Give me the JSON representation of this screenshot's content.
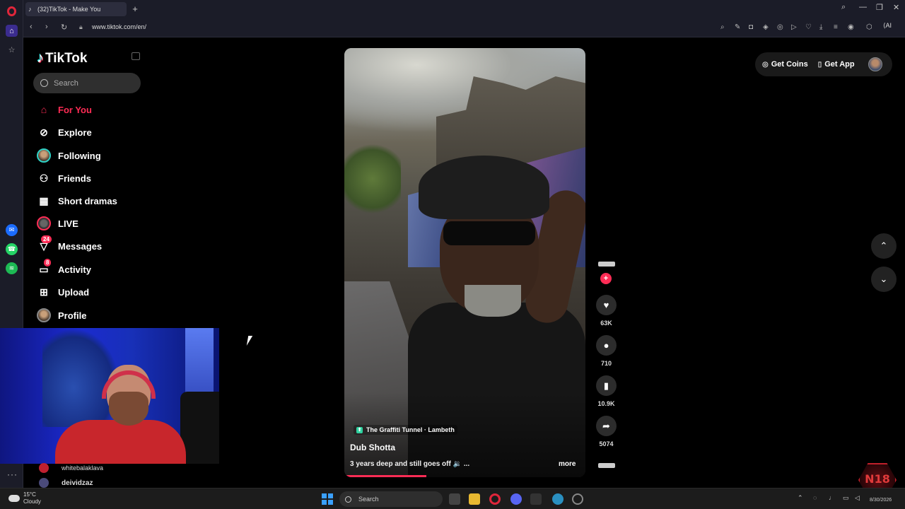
{
  "browser": {
    "tab_title": "(32)TikTok - Make You",
    "url": "www.tiktok.com/en/",
    "ai_label": "AI"
  },
  "tiktok": {
    "brand": "TikTok",
    "search_placeholder": "Search",
    "nav": [
      {
        "label": "For You",
        "icon": "home-icon",
        "active": true
      },
      {
        "label": "Explore",
        "icon": "compass-icon"
      },
      {
        "label": "Following",
        "icon": "following-avatar-icon"
      },
      {
        "label": "Friends",
        "icon": "friends-icon"
      },
      {
        "label": "Short dramas",
        "icon": "film-icon"
      },
      {
        "label": "LIVE",
        "icon": "live-icon"
      },
      {
        "label": "Messages",
        "icon": "messages-icon",
        "badge": "24"
      },
      {
        "label": "Activity",
        "icon": "activity-icon",
        "badge": "8"
      },
      {
        "label": "Upload",
        "icon": "upload-icon"
      },
      {
        "label": "Profile",
        "icon": "profile-avatar-icon"
      }
    ],
    "topbar": {
      "get_coins": "Get Coins",
      "get_app": "Get App"
    },
    "video": {
      "location": "The Graffiti Tunnel · Lambeth",
      "author": "Dub Shotta",
      "caption": "3 years deep and still goes off 🔉 ...",
      "more": "more",
      "progress": 0.34
    },
    "actions": {
      "likes": "63K",
      "comments": "710",
      "saves": "10.9K",
      "shares": "5074"
    }
  },
  "stream_chat": [
    {
      "name": "whitebalaklava"
    },
    {
      "name": "deividzaz"
    }
  ],
  "overlay_logo": "N18",
  "taskbar": {
    "temperature": "15°C",
    "weather": "Cloudy",
    "search_label": "Search",
    "date": "8/30/2026"
  },
  "colors": {
    "accent": "#fe2c55",
    "background": "#000000"
  }
}
